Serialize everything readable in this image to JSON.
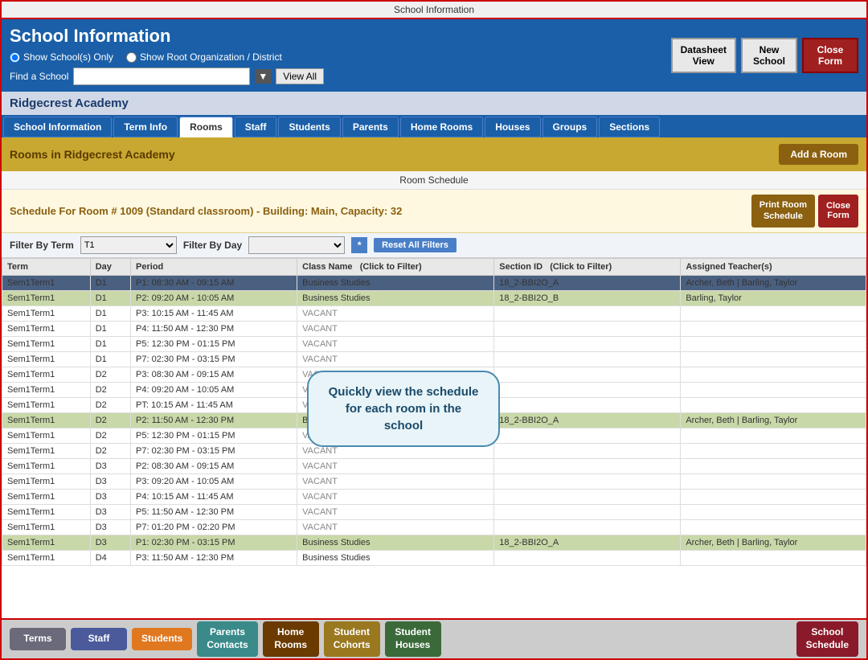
{
  "titleBar": {
    "label": "School Information"
  },
  "header": {
    "title": "School Information",
    "radio1": "Show School(s) Only",
    "radio2": "Show Root Organization / District",
    "findLabel": "Find a School",
    "viewAllBtn": "View All",
    "datasheetBtn": "Datasheet\nView",
    "newSchoolBtn": "New\nSchool",
    "closeFormBtn": "Close\nForm"
  },
  "schoolName": "Ridgecrest Academy",
  "navTabs": [
    {
      "label": "School Information"
    },
    {
      "label": "Term Info"
    },
    {
      "label": "Rooms",
      "active": true
    },
    {
      "label": "Staff"
    },
    {
      "label": "Students"
    },
    {
      "label": "Parents"
    },
    {
      "label": "Home Rooms"
    },
    {
      "label": "Houses"
    },
    {
      "label": "Groups"
    },
    {
      "label": "Sections"
    }
  ],
  "roomsHeader": {
    "title": "Rooms in Ridgecrest Academy",
    "addRoomBtn": "Add a Room"
  },
  "roomSchedule": {
    "sectionTitle": "Room Schedule",
    "scheduleTitle": "Schedule For Room # 1009 (Standard classroom) - Building: Main, Capacity: 32",
    "printBtn": "Print Room\nSchedule",
    "closeBtn": "Close\nForm",
    "filterByTermLabel": "Filter By Term",
    "filterByTermValue": "T1",
    "filterByDayLabel": "Filter By Day",
    "resetBtn": "Reset All Filters"
  },
  "tableHeaders": [
    "Term",
    "Day",
    "Period",
    "Class Name  (Click to Filter)",
    "Section ID  (Click to Filter)",
    "Assigned Teacher(s)"
  ],
  "tableRows": [
    {
      "term": "Sem1Term1",
      "day": "D1",
      "period": "P1: 08:30 AM - 09:15 AM",
      "className": "Business Studies",
      "sectionId": "18_2-BBI2O_A",
      "teacher": "Archer, Beth | Barling, Taylor",
      "highlight": "selected"
    },
    {
      "term": "Sem1Term1",
      "day": "D1",
      "period": "P2: 09:20 AM - 10:05 AM",
      "className": "Business Studies",
      "sectionId": "18_2-BBI2O_B",
      "teacher": "Barling, Taylor",
      "highlight": "green"
    },
    {
      "term": "Sem1Term1",
      "day": "D1",
      "period": "P3: 10:15 AM - 11:45 AM",
      "className": "VACANT",
      "sectionId": "",
      "teacher": "",
      "highlight": "none"
    },
    {
      "term": "Sem1Term1",
      "day": "D1",
      "period": "P4: 11:50 AM - 12:30 PM",
      "className": "VACANT",
      "sectionId": "",
      "teacher": "",
      "highlight": "none"
    },
    {
      "term": "Sem1Term1",
      "day": "D1",
      "period": "P5: 12:30 PM - 01:15 PM",
      "className": "VACANT",
      "sectionId": "",
      "teacher": "",
      "highlight": "none"
    },
    {
      "term": "Sem1Term1",
      "day": "D1",
      "period": "P7: 02:30 PM - 03:15 PM",
      "className": "VACANT",
      "sectionId": "",
      "teacher": "",
      "highlight": "none"
    },
    {
      "term": "Sem1Term1",
      "day": "D2",
      "period": "P3: 08:30 AM - 09:15 AM",
      "className": "VACANT",
      "sectionId": "",
      "teacher": "",
      "highlight": "none"
    },
    {
      "term": "Sem1Term1",
      "day": "D2",
      "period": "P4: 09:20 AM - 10:05 AM",
      "className": "VACANT",
      "sectionId": "",
      "teacher": "",
      "highlight": "none"
    },
    {
      "term": "Sem1Term1",
      "day": "D2",
      "period": "PT: 10:15 AM - 11:45 AM",
      "className": "VACANT",
      "sectionId": "",
      "teacher": "",
      "highlight": "none"
    },
    {
      "term": "Sem1Term1",
      "day": "D2",
      "period": "P2: 11:50 AM - 12:30 PM",
      "className": "Business Studies",
      "sectionId": "18_2-BBI2O_A",
      "teacher": "Archer, Beth | Barling, Taylor",
      "highlight": "green"
    },
    {
      "term": "Sem1Term1",
      "day": "D2",
      "period": "P5: 12:30 PM - 01:15 PM",
      "className": "VACANT",
      "sectionId": "",
      "teacher": "",
      "highlight": "none"
    },
    {
      "term": "Sem1Term1",
      "day": "D2",
      "period": "P7: 02:30 PM - 03:15 PM",
      "className": "VACANT",
      "sectionId": "",
      "teacher": "",
      "highlight": "none"
    },
    {
      "term": "Sem1Term1",
      "day": "D3",
      "period": "P2: 08:30 AM - 09:15 AM",
      "className": "VACANT",
      "sectionId": "",
      "teacher": "",
      "highlight": "none"
    },
    {
      "term": "Sem1Term1",
      "day": "D3",
      "period": "P3: 09:20 AM - 10:05 AM",
      "className": "VACANT",
      "sectionId": "",
      "teacher": "",
      "highlight": "none"
    },
    {
      "term": "Sem1Term1",
      "day": "D3",
      "period": "P4: 10:15 AM - 11:45 AM",
      "className": "VACANT",
      "sectionId": "",
      "teacher": "",
      "highlight": "none"
    },
    {
      "term": "Sem1Term1",
      "day": "D3",
      "period": "P5: 11:50 AM - 12:30 PM",
      "className": "VACANT",
      "sectionId": "",
      "teacher": "",
      "highlight": "none"
    },
    {
      "term": "Sem1Term1",
      "day": "D3",
      "period": "P7: 01:20 PM - 02:20 PM",
      "className": "VACANT",
      "sectionId": "",
      "teacher": "",
      "highlight": "none"
    },
    {
      "term": "Sem1Term1",
      "day": "D3",
      "period": "P1: 02:30 PM - 03:15 PM",
      "className": "Business Studies",
      "sectionId": "18_2-BBI2O_A",
      "teacher": "Archer, Beth | Barling, Taylor",
      "highlight": "green"
    },
    {
      "term": "Sem1Term1",
      "day": "D4",
      "period": "P3: 11:50 AM - 12:30 PM",
      "className": "Business Studies",
      "sectionId": "",
      "teacher": "",
      "highlight": "none"
    }
  ],
  "tooltip": {
    "text": "Quickly view the schedule\nfor each room in the school"
  },
  "bottomNav": [
    {
      "label": "Terms",
      "style": "terms"
    },
    {
      "label": "Staff",
      "style": "staff"
    },
    {
      "label": "Students",
      "style": "students"
    },
    {
      "label": "Parents\nContacts",
      "style": "parents"
    },
    {
      "label": "Home\nRooms",
      "style": "homerooms"
    },
    {
      "label": "Student\nCohorts",
      "style": "student-cohorts"
    },
    {
      "label": "Student\nHouses",
      "style": "student-houses"
    },
    {
      "label": "School\nSchedule",
      "style": "school-schedule"
    }
  ]
}
